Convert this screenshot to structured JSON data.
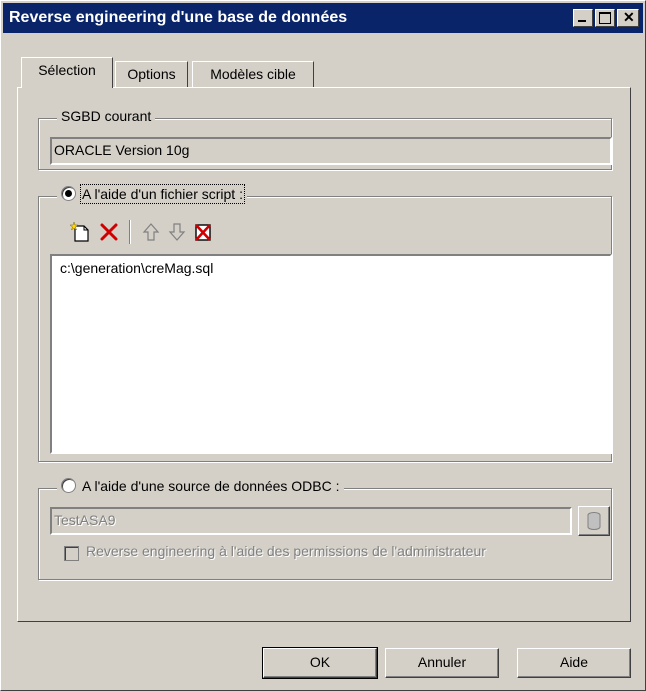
{
  "window": {
    "title": "Reverse engineering d'une base de données"
  },
  "tabs": [
    {
      "label": "Sélection",
      "active": true
    },
    {
      "label": "Options",
      "active": false
    },
    {
      "label": "Modèles cible",
      "active": false
    }
  ],
  "sgbd": {
    "group_label": "SGBD courant",
    "value": "ORACLE Version 10g"
  },
  "script_source": {
    "radio_label": "A l'aide d'un fichier script :",
    "selected": true,
    "toolbar_icons": [
      "new-file-icon",
      "delete-icon",
      "move-up-icon",
      "move-down-icon",
      "clear-all-icon"
    ],
    "files": [
      "c:\\generation\\creMag.sql"
    ]
  },
  "odbc_source": {
    "radio_label": "A l'aide d'une source de données ODBC :",
    "selected": false,
    "data_source": "TestASA9",
    "admin_checkbox_label": "Reverse engineering à l'aide des permissions de l'administrateur",
    "admin_checked": false
  },
  "buttons": {
    "ok": "OK",
    "cancel": "Annuler",
    "help": "Aide"
  },
  "colors": {
    "titlebar": "#0a246a",
    "face": "#d4d0c8",
    "delete_icon": "#d00000"
  }
}
